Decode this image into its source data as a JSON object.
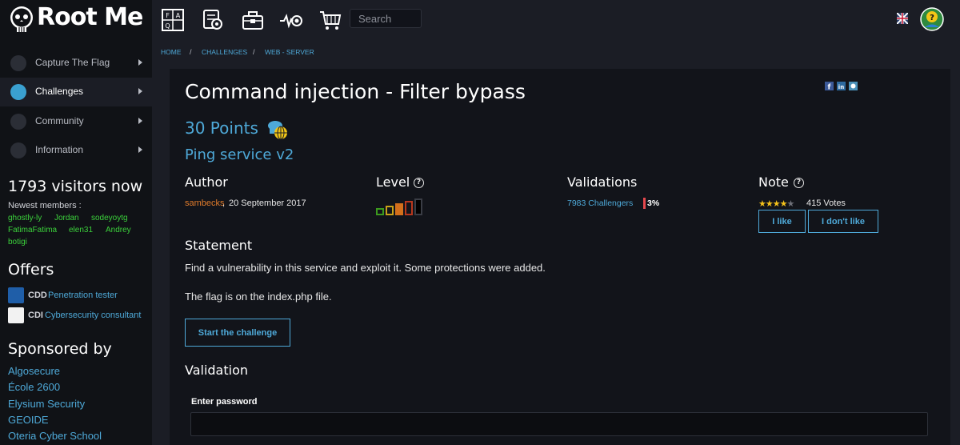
{
  "app": {
    "logo_text": "Root Me"
  },
  "topbar": {
    "icons": [
      "faq-icon",
      "documentation-icon",
      "tools-icon",
      "news-icon",
      "shop-icon"
    ],
    "search_placeholder": "Search"
  },
  "sidebar": {
    "items": [
      {
        "label": "Capture The Flag",
        "icon": "ctf-icon",
        "active": false
      },
      {
        "label": "Challenges",
        "icon": "challenges-icon",
        "active": true
      },
      {
        "label": "Community",
        "icon": "community-icon",
        "active": false
      },
      {
        "label": "Information",
        "icon": "information-icon",
        "active": false
      }
    ],
    "visitors": "1793 visitors now",
    "newest_label": "Newest members :",
    "members": [
      "ghostly-ly",
      "Jordan",
      "sodeyoytg",
      "FatimaFatima",
      "elen31",
      "Andrey",
      "botigi"
    ],
    "offers_title": "Offers",
    "offers": [
      {
        "code": "CDD",
        "label": "Penetration tester"
      },
      {
        "code": "CDI",
        "label": "Cybersecurity consultant"
      }
    ],
    "sponsored_title": "Sponsored by",
    "sponsors": [
      "Algosecure",
      "École 2600",
      "Elysium Security",
      "GEOIDE",
      "Oteria Cyber School"
    ]
  },
  "breadcrumb": [
    "HOME",
    "CHALLENGES",
    "WEB - SERVER"
  ],
  "challenge": {
    "title": "Command injection - Filter bypass",
    "points": "30 Points",
    "subtitle": "Ping service v2",
    "author_heading": "Author",
    "author": "sambecks",
    "date": "20 September 2017",
    "level_heading": "Level",
    "level": 3,
    "level_max": 5,
    "validations_heading": "Validations",
    "validations": "7983 Challengers",
    "validation_percent": "3%",
    "note_heading": "Note",
    "rating": 4,
    "rating_max": 5,
    "votes": "415 Votes",
    "like_label": "I like",
    "dislike_label": "I don't like",
    "statement_heading": "Statement",
    "statement_lines": [
      "Find a vulnerability in this service and exploit it. Some protections were added.",
      "The flag is on the index.php file."
    ],
    "start_label": "Start the challenge",
    "validation_heading": "Validation",
    "password_label": "Enter password"
  },
  "colors": {
    "accent": "#4ea9d8",
    "author": "#e07b2b",
    "member": "#3bd13b",
    "star": "#f4c21b",
    "level_colors": [
      "#3c9a1e",
      "#c9a21a",
      "#d36f1b",
      "#b8371d",
      "#000000"
    ]
  }
}
